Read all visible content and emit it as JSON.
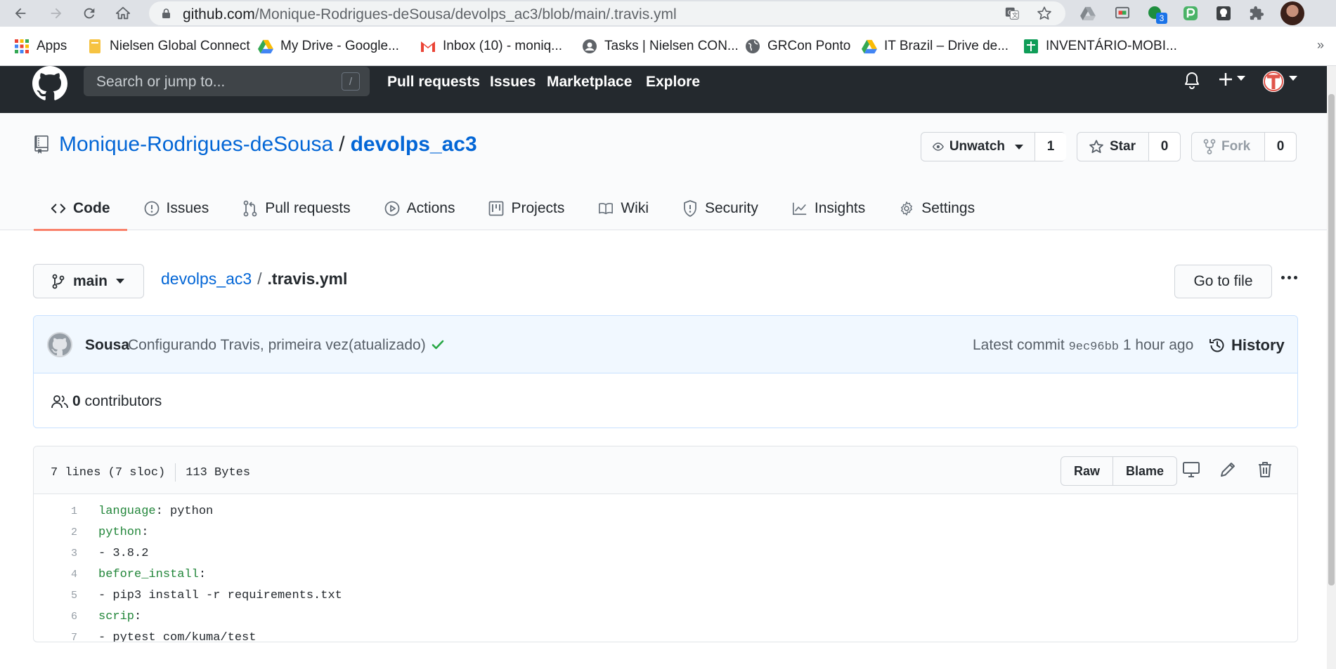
{
  "browser": {
    "url_host": "github.com",
    "url_path": "/Monique-Rodrigues-deSousa/devolps_ac3/blob/main/.travis.yml",
    "extension_badge": "3",
    "bookmarks": [
      {
        "label": "Apps",
        "icon": "apps-grid-icon"
      },
      {
        "label": "Nielsen Global Connect",
        "icon": "folder-icon"
      },
      {
        "label": "My Drive - Google...",
        "icon": "google-drive-icon"
      },
      {
        "label": "Inbox (10) - moniq...",
        "icon": "gmail-icon"
      },
      {
        "label": "Tasks | Nielsen CON...",
        "icon": "user-icon"
      },
      {
        "label": "GRCon Ponto",
        "icon": "globe-icon"
      },
      {
        "label": "IT Brazil – Drive de...",
        "icon": "google-drive-icon"
      },
      {
        "label": "INVENTÁRIO-MOBI...",
        "icon": "sheets-icon"
      }
    ],
    "bookmarks_more": "»"
  },
  "header": {
    "search_placeholder": "Search or jump to...",
    "search_key": "/",
    "nav": [
      "Pull requests",
      "Issues",
      "Marketplace",
      "Explore"
    ]
  },
  "repo": {
    "owner": "Monique-Rodrigues-deSousa",
    "separator": "/",
    "name": "devolps_ac3",
    "watch_label": "Unwatch",
    "watch_count": "1",
    "star_label": "Star",
    "star_count": "0",
    "fork_label": "Fork",
    "fork_count": "0",
    "tabs": [
      "Code",
      "Issues",
      "Pull requests",
      "Actions",
      "Projects",
      "Wiki",
      "Security",
      "Insights",
      "Settings"
    ]
  },
  "file_nav": {
    "branch": "main",
    "crumb_repo": "devolps_ac3",
    "crumb_sep": "/",
    "crumb_file": ".travis.yml",
    "goto_label": "Go to file"
  },
  "commit": {
    "author": "Sousa",
    "message": "Configurando Travis, primeira vez(atualizado)",
    "latest_label": "Latest commit",
    "sha": "9ec96bb",
    "time": "1 hour ago",
    "history_label": "History",
    "contributors_count": "0",
    "contributors_label": "contributors"
  },
  "file": {
    "lines_info": "7 lines (7 sloc)",
    "size_info": "113 Bytes",
    "raw_label": "Raw",
    "blame_label": "Blame",
    "lines": [
      {
        "n": "1",
        "key": "language",
        "rest": ": python"
      },
      {
        "n": "2",
        "key": "python",
        "rest": ":"
      },
      {
        "n": "3",
        "key": "",
        "rest": "- 3.8.2"
      },
      {
        "n": "4",
        "key": "before_install",
        "rest": ":"
      },
      {
        "n": "5",
        "key": "",
        "rest": "- pip3 install -r requirements.txt"
      },
      {
        "n": "6",
        "key": "scrip",
        "rest": ":"
      },
      {
        "n": "7",
        "key": "",
        "rest": "- pytest com/kuma/test"
      }
    ]
  },
  "colors": {
    "header_bg": "#24292e",
    "link_blue": "#0366d6",
    "tab_underline": "#f9826c",
    "yaml_key_green": "#22863a",
    "success_green": "#28a745"
  }
}
